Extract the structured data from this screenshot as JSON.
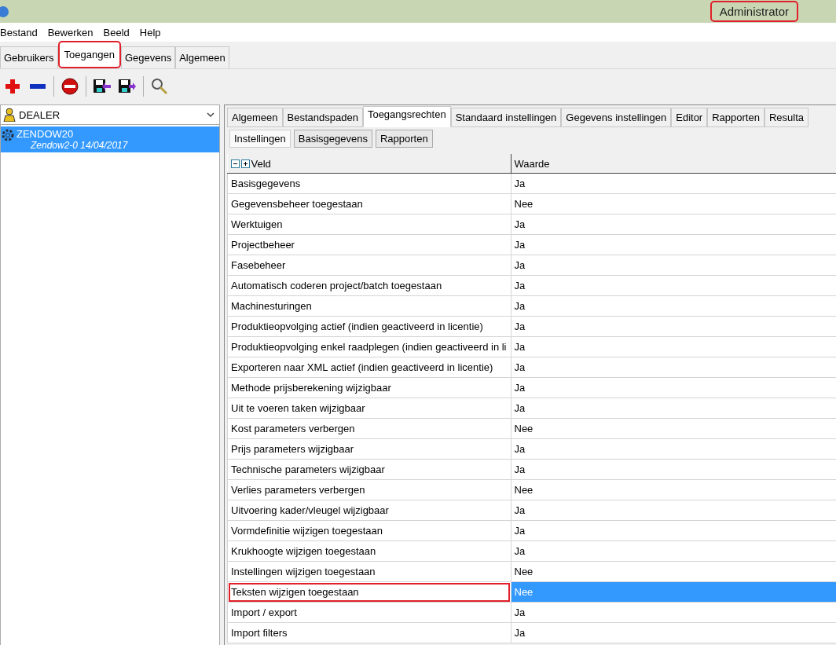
{
  "window": {
    "user": "Administrator",
    "user_highlighted": true
  },
  "menu": [
    "Bestand",
    "Bewerken",
    "Beeld",
    "Help"
  ],
  "tabs": [
    {
      "label": "Gebruikers",
      "selected": false,
      "highlighted": false
    },
    {
      "label": "Toegangen",
      "selected": true,
      "highlighted": true
    },
    {
      "label": "Gegevens",
      "selected": false,
      "highlighted": false
    },
    {
      "label": "Algemeen",
      "selected": false,
      "highlighted": false
    }
  ],
  "sidebar": {
    "dropdown": "DEALER",
    "items": [
      {
        "title": "ZENDOW20",
        "subtitle": "Zendow2-0 14/04/2017",
        "selected": true
      }
    ]
  },
  "detail_tabs": [
    {
      "label": "Algemeen",
      "selected": false
    },
    {
      "label": "Bestandspaden",
      "selected": false
    },
    {
      "label": "Toegangsrechten",
      "selected": true
    },
    {
      "label": "Standaard instellingen",
      "selected": false
    },
    {
      "label": "Gegevens instellingen",
      "selected": false
    },
    {
      "label": "Editor",
      "selected": false
    },
    {
      "label": "Rapporten",
      "selected": false
    },
    {
      "label": "Resulta",
      "selected": false
    }
  ],
  "sub_tabs": [
    {
      "label": "Instellingen",
      "selected": true
    },
    {
      "label": "Basisgegevens",
      "selected": false
    },
    {
      "label": "Rapporten",
      "selected": false
    }
  ],
  "table": {
    "columns": [
      "Veld",
      "Waarde"
    ],
    "rows": [
      {
        "field": "Basisgegevens",
        "value": "Ja",
        "selected": false
      },
      {
        "field": "Gegevensbeheer toegestaan",
        "value": "Nee",
        "selected": false
      },
      {
        "field": "Werktuigen",
        "value": "Ja",
        "selected": false
      },
      {
        "field": "Projectbeheer",
        "value": "Ja",
        "selected": false
      },
      {
        "field": "Fasebeheer",
        "value": "Ja",
        "selected": false
      },
      {
        "field": "Automatisch coderen project/batch toegestaan",
        "value": "Ja",
        "selected": false
      },
      {
        "field": "Machinesturingen",
        "value": "Ja",
        "selected": false
      },
      {
        "field": "Produktieopvolging actief (indien geactiveerd in licentie)",
        "value": "Ja",
        "selected": false
      },
      {
        "field": "Produktieopvolging enkel raadplegen (indien geactiveerd in li",
        "value": "Ja",
        "selected": false
      },
      {
        "field": "Exporteren naar XML actief (indien geactiveerd in licentie)",
        "value": "Ja",
        "selected": false
      },
      {
        "field": "Methode prijsberekening wijzigbaar",
        "value": "Ja",
        "selected": false
      },
      {
        "field": "Uit te voeren taken wijzigbaar",
        "value": "Ja",
        "selected": false
      },
      {
        "field": "Kost parameters verbergen",
        "value": "Nee",
        "selected": false
      },
      {
        "field": "Prijs parameters wijzigbaar",
        "value": "Ja",
        "selected": false
      },
      {
        "field": "Technische parameters wijzigbaar",
        "value": "Ja",
        "selected": false
      },
      {
        "field": "Verlies parameters verbergen",
        "value": "Nee",
        "selected": false
      },
      {
        "field": "Uitvoering kader/vleugel wijzigbaar",
        "value": "Ja",
        "selected": false
      },
      {
        "field": "Vormdefinitie wijzigen toegestaan",
        "value": "Ja",
        "selected": false
      },
      {
        "field": "Krukhoogte wijzigen toegestaan",
        "value": "Ja",
        "selected": false
      },
      {
        "field": "Instellingen wijzigen toegestaan",
        "value": "Nee",
        "selected": false
      },
      {
        "field": "Teksten wijzigen toegestaan",
        "value": "Nee",
        "selected": true
      },
      {
        "field": "Import / export",
        "value": "Ja",
        "selected": false
      },
      {
        "field": "Import filters",
        "value": "Ja",
        "selected": false
      }
    ]
  }
}
